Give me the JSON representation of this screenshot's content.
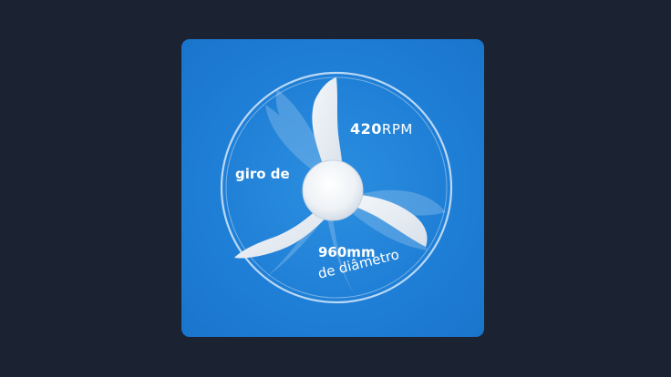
{
  "colors": {
    "background": "#1b2333",
    "card": "#1f7fd6",
    "blade": "#e6ecf3",
    "ring": "#cfe4fa"
  },
  "icons": {
    "fan": "three-blade-fan-icon"
  },
  "spec": {
    "speed_value": "420",
    "speed_unit": "RPM",
    "speed_prefix": "giro de",
    "diameter_value": "960mm",
    "diameter_caption": "de diâmetro"
  }
}
